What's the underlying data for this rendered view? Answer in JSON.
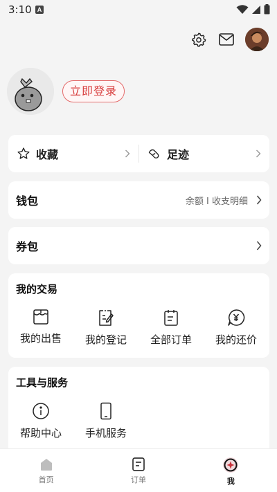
{
  "status_bar": {
    "time": "3:10",
    "badge": "A"
  },
  "profile": {
    "login_label": "立即登录"
  },
  "favorites": {
    "favorites_label": "收藏",
    "footprints_label": "足迹"
  },
  "wallet": {
    "label": "钱包",
    "detail": "余额 I 收支明细"
  },
  "coupons": {
    "label": "券包"
  },
  "trade": {
    "title": "我的交易",
    "items": [
      {
        "label": "我的出售",
        "icon": "shop-icon"
      },
      {
        "label": "我的登记",
        "icon": "register-icon"
      },
      {
        "label": "全部订单",
        "icon": "orders-icon"
      },
      {
        "label": "我的还价",
        "icon": "bargain-icon"
      }
    ]
  },
  "tools": {
    "title": "工具与服务",
    "items": [
      {
        "label": "帮助中心",
        "icon": "info-icon"
      },
      {
        "label": "手机服务",
        "icon": "phone-icon"
      }
    ]
  },
  "bottom_nav": [
    {
      "label": "首页",
      "icon": "home-icon",
      "active": false
    },
    {
      "label": "订单",
      "icon": "order-icon",
      "active": false
    },
    {
      "label": "我",
      "icon": "me-icon",
      "active": true
    }
  ],
  "colors": {
    "accent": "#d83e3e",
    "background": "#f4f4f4"
  }
}
